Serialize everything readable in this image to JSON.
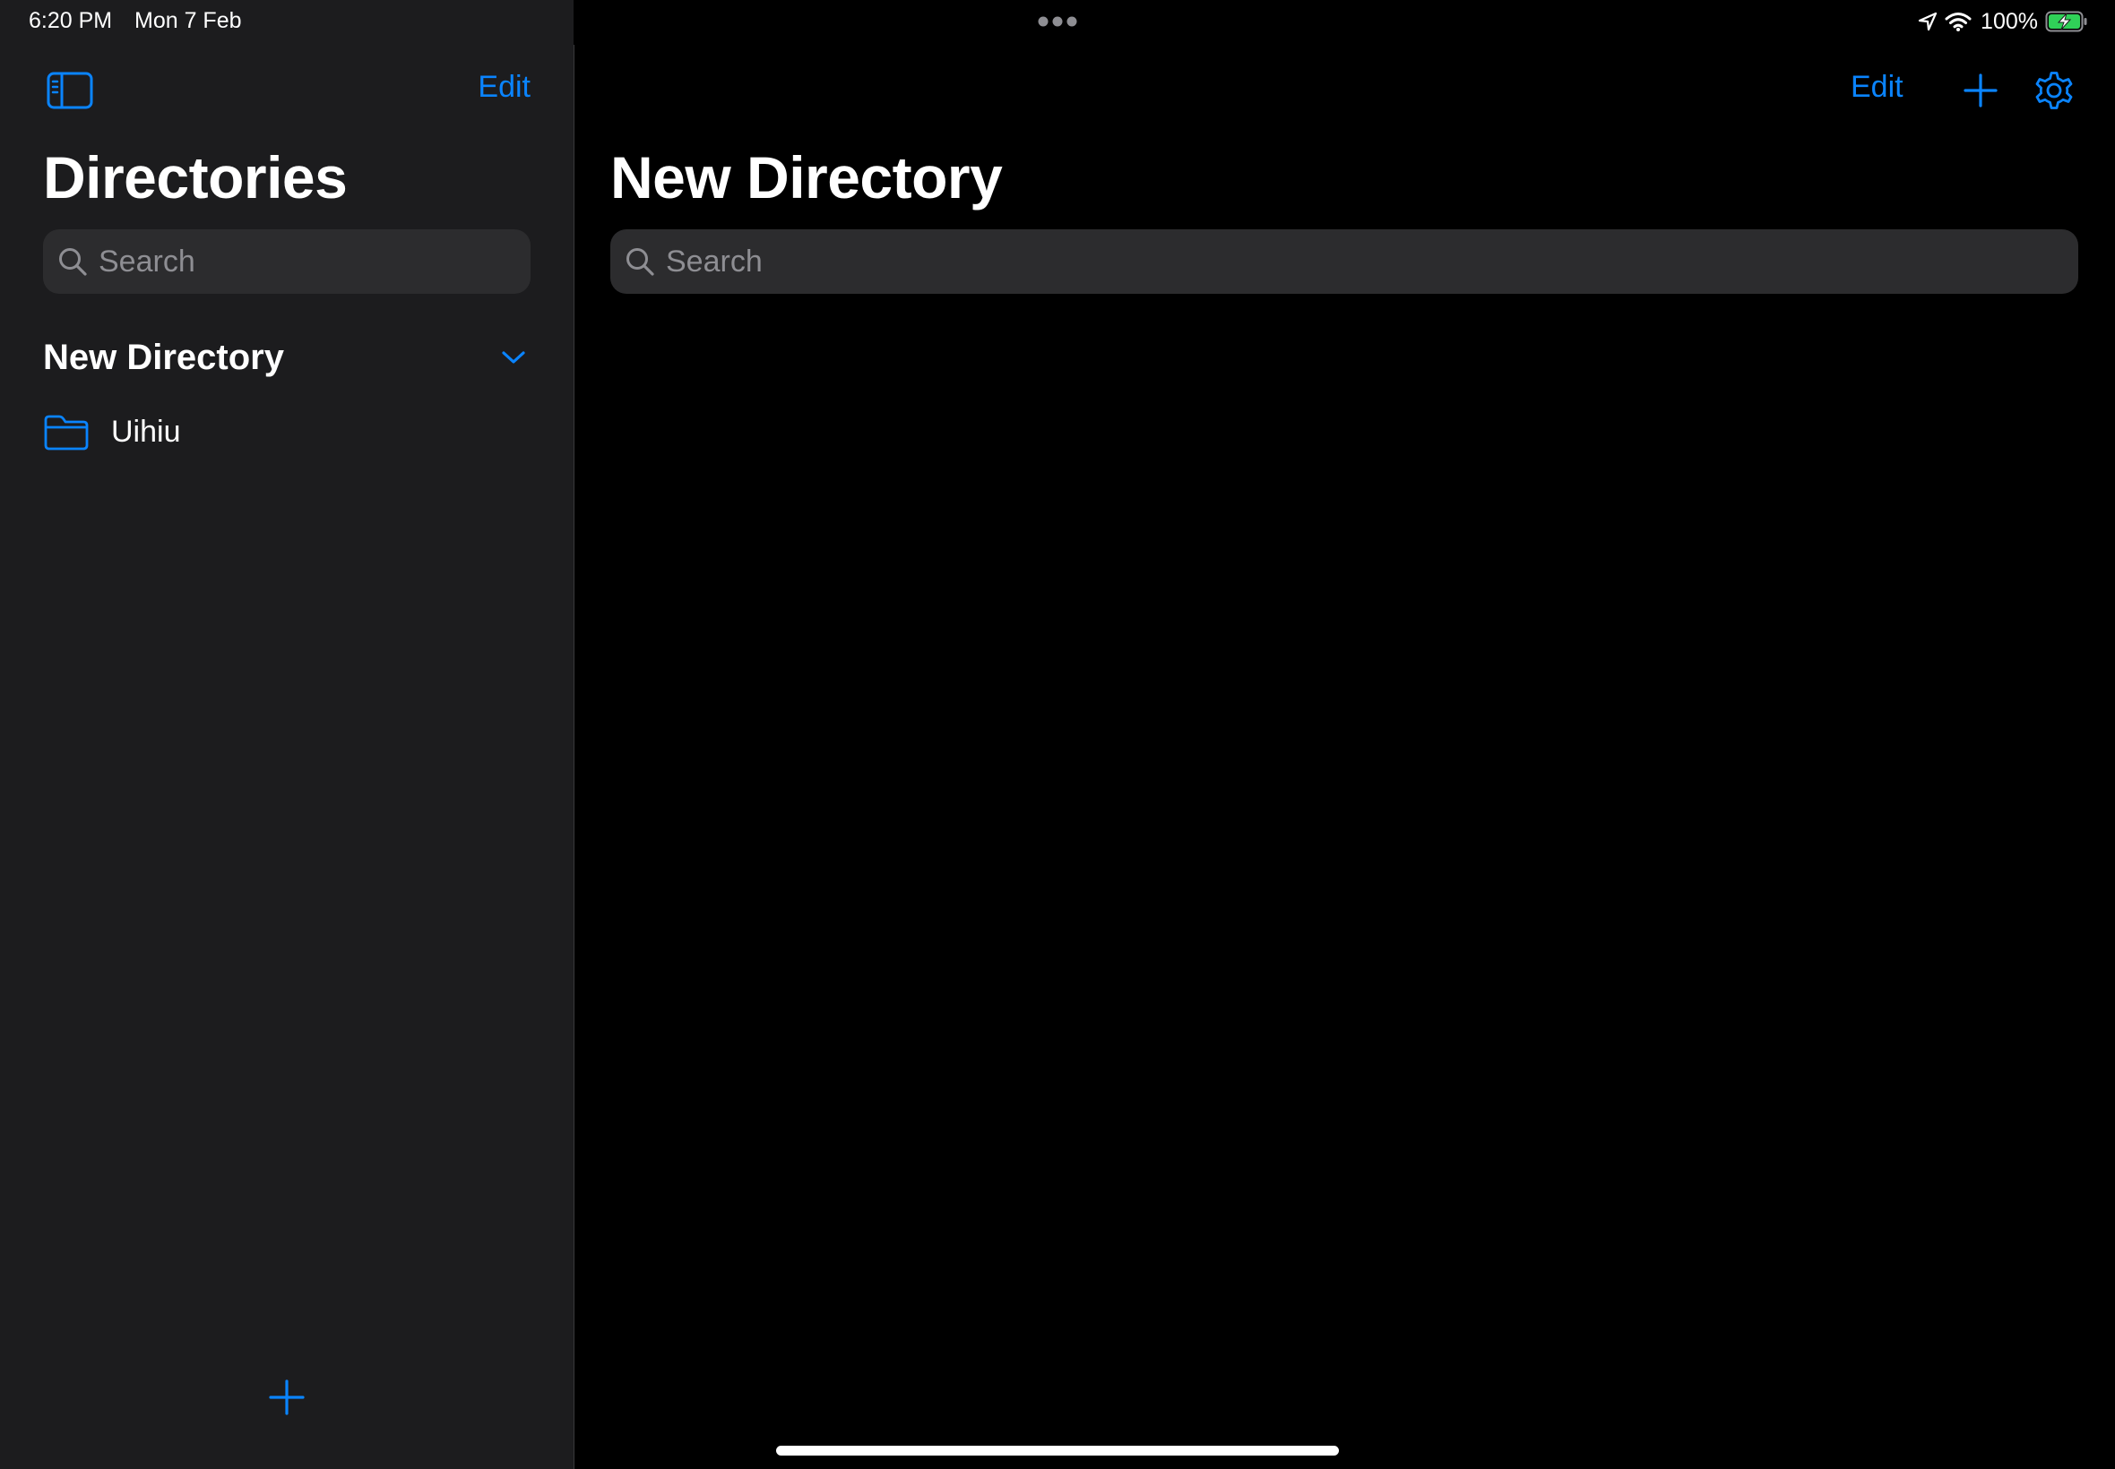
{
  "status_bar": {
    "time": "6:20 PM",
    "date": "Mon 7 Feb",
    "battery_percent": "100%",
    "icons": [
      "location-arrow-icon",
      "wifi-icon",
      "battery-charging-icon"
    ]
  },
  "sidebar": {
    "edit_label": "Edit",
    "title": "Directories",
    "search_placeholder": "Search",
    "section": {
      "title": "New Directory",
      "expanded": true,
      "items": [
        {
          "label": "Uihiu",
          "icon": "folder-icon"
        }
      ]
    }
  },
  "detail": {
    "edit_label": "Edit",
    "title": "New Directory",
    "search_placeholder": "Search"
  },
  "colors": {
    "accent": "#0a84ff",
    "sidebar_background": "#1c1c1e",
    "detail_background": "#000000",
    "search_background": "#2c2c2e",
    "placeholder": "#8e8e93",
    "battery_green": "#30d158"
  }
}
